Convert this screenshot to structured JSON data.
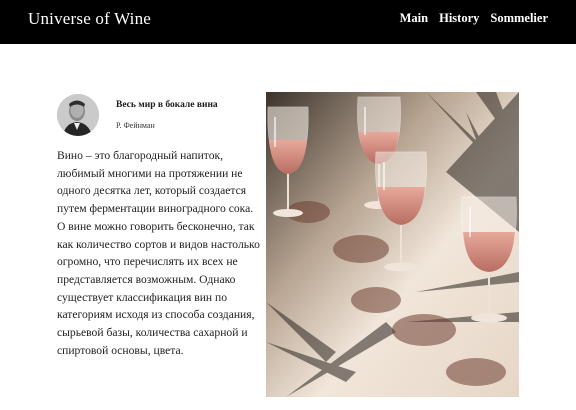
{
  "header": {
    "logo": "Universe of Wine",
    "nav": [
      {
        "label": "Main"
      },
      {
        "label": "History"
      },
      {
        "label": "Sommelier"
      }
    ]
  },
  "quote": {
    "title": "Весь мир в бокале вина",
    "author": "Р. Фейнман"
  },
  "article": {
    "text": "Вино – это благородный напиток, любимый многими на протяжении не одного десятка лет, который создается путем ферментации виноградного сока. О вине можно говорить бесконечно, так как количество сортов и видов настолько огромно, что перечислять их всех не представляется возможным. Однако существует классификация вин по категориям исходя из способа создания, сырьевой базы, количества сахарной и спиртовой основы, цвета."
  },
  "colors": {
    "header_bg": "#000000",
    "header_text": "#ffffff",
    "wine": "#d9958a"
  },
  "icons": {
    "avatar": "portrait-photo",
    "photo": "rose-wine-glasses-photo"
  }
}
